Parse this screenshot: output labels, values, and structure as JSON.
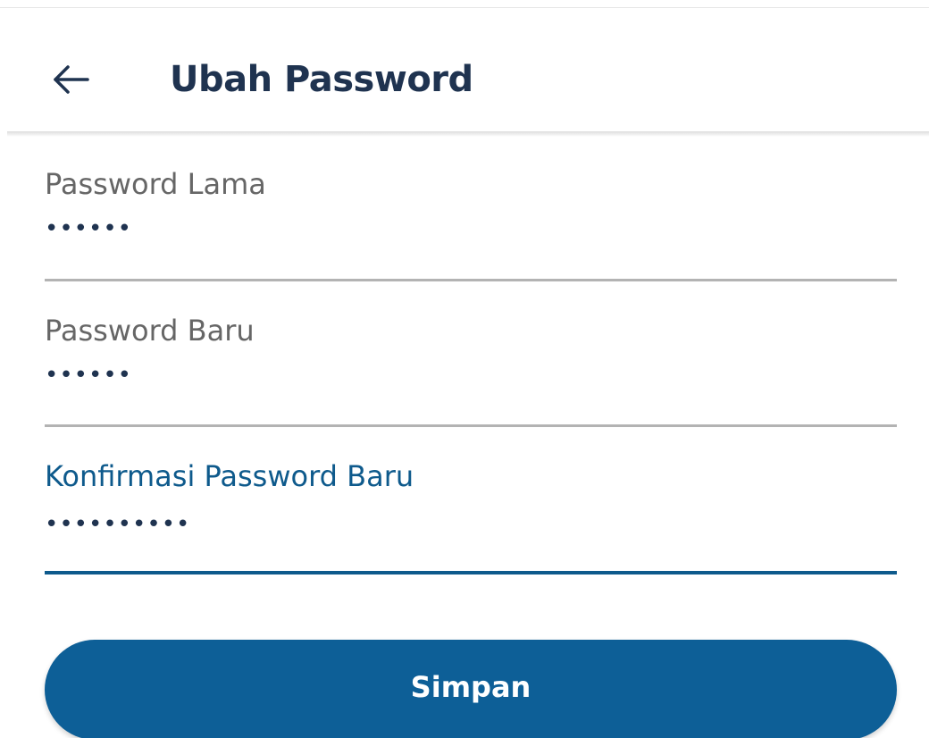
{
  "header": {
    "back_icon": "arrow-left-icon",
    "title": "Ubah Password"
  },
  "form": {
    "fields": [
      {
        "label": "Password Lama",
        "value": "••••••",
        "focused": false
      },
      {
        "label": "Password Baru",
        "value": "••••••",
        "focused": false
      },
      {
        "label": "Konfirmasi Password Baru",
        "value": "••••••••••",
        "focused": true
      }
    ],
    "save_label": "Simpan"
  },
  "colors": {
    "primary": "#0d5f97",
    "title_text": "#1f3350",
    "label_text": "#666666",
    "focused_label": "#0e5a8c",
    "underline": "#b3b3b3"
  }
}
